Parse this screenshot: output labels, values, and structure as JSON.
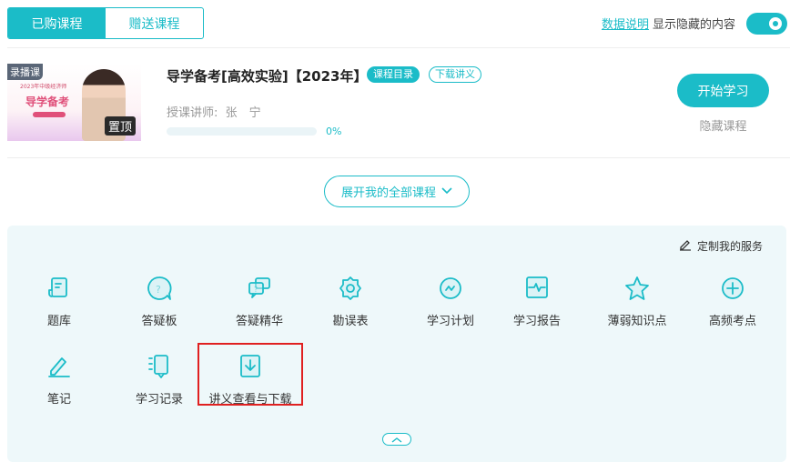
{
  "tabs": [
    {
      "label": "已购课程",
      "active": true
    },
    {
      "label": "赠送课程",
      "active": false
    }
  ],
  "top": {
    "data_link": "数据说明",
    "show_hidden": "显示隐藏的内容",
    "toggle_on": true
  },
  "course": {
    "thumb": {
      "tag": "录播课",
      "line1": "2023年中级经济师",
      "line2": "导学备考",
      "pin": "置顶"
    },
    "title": "导学备考[高效实验]【2023年】",
    "badge_catalog": "课程目录",
    "badge_download": "下载讲义",
    "teacher_label": "授课讲师:",
    "teacher": "张　宁",
    "progress": "0%",
    "progress_value": 0,
    "start": "开始学习",
    "hide": "隐藏课程"
  },
  "expand": "展开我的全部课程",
  "services": {
    "custom": "定制我的服务",
    "items": [
      "题库",
      "答疑板",
      "答疑精华",
      "勘误表",
      "学习计划",
      "学习报告",
      "薄弱知识点",
      "高频考点",
      "笔记",
      "学习记录",
      "讲义查看与下载"
    ]
  },
  "accent": "#1bbcc8"
}
